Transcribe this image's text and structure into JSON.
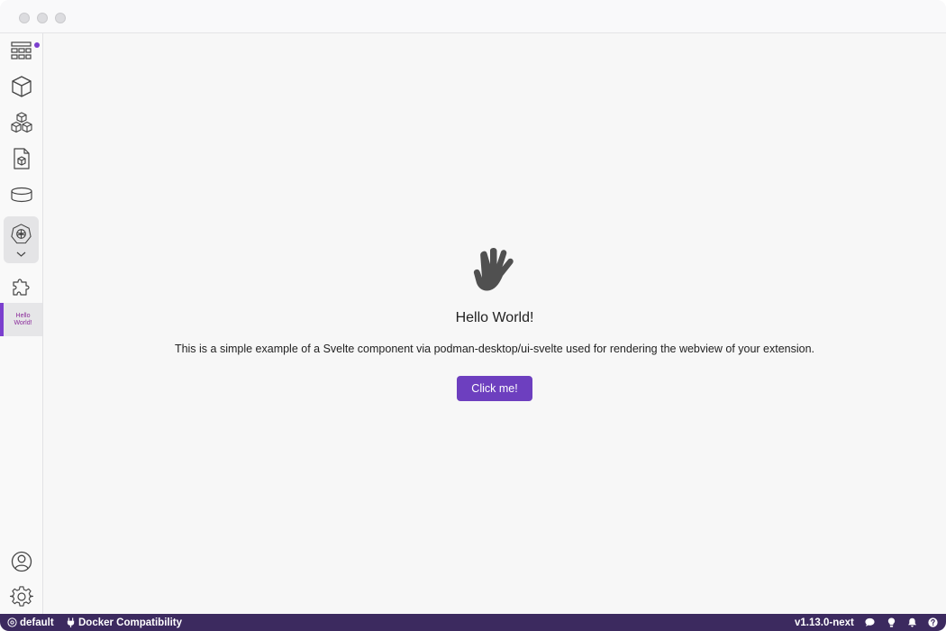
{
  "sidebar": {
    "items": [
      {
        "name": "dashboard",
        "icon": "dashboard-icon"
      },
      {
        "name": "containers",
        "icon": "cube-icon"
      },
      {
        "name": "pods",
        "icon": "cubes-icon"
      },
      {
        "name": "images",
        "icon": "image-file-icon"
      },
      {
        "name": "volumes",
        "icon": "volume-icon"
      },
      {
        "name": "kubernetes",
        "icon": "kubernetes-icon"
      },
      {
        "name": "extensions",
        "icon": "puzzle-icon"
      }
    ],
    "extension_item": {
      "label": "Hello World!"
    },
    "bottom": [
      {
        "name": "account",
        "icon": "user-circle-icon"
      },
      {
        "name": "settings",
        "icon": "gear-icon"
      }
    ],
    "accent_color": "#7b3fce"
  },
  "main": {
    "icon": "waving-hand-icon",
    "title": "Hello World!",
    "description": "This is a simple example of a Svelte component via podman-desktop/ui-svelte used for rendering the webview of your extension.",
    "button_label": "Click me!",
    "button_color": "#6d3fbf"
  },
  "statusbar": {
    "background": "#3c2a5f",
    "context": "default",
    "compat": "Docker Compatibility",
    "version": "v1.13.0-next"
  }
}
